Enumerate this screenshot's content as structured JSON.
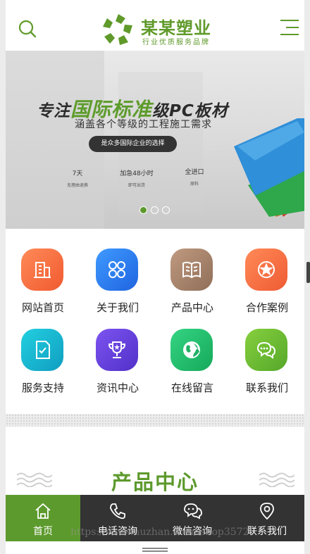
{
  "header": {
    "brand_name": "某某塑业",
    "brand_slogan": "行业优质服务品牌",
    "brand_color": "#5f9a2a"
  },
  "banner": {
    "headline_prefix": "专注",
    "headline_highlight": "国际标准",
    "headline_suffix": "级PC板材",
    "subline": "涵盖各个等级的工程施工需求",
    "pill_text": "是众多国际企业的选择",
    "features": [
      {
        "title": "7天",
        "sub": "无理由退换"
      },
      {
        "title": "加急48小时",
        "sub": "即可出货"
      },
      {
        "title": "全进口",
        "sub": "原料"
      }
    ],
    "slides": [
      "1",
      "2",
      "3"
    ],
    "active_slide": 0
  },
  "nav_grid": [
    {
      "label": "网站首页",
      "icon": "building-icon",
      "color": "#f36b3c"
    },
    {
      "label": "关于我们",
      "icon": "clover-icon",
      "color": "#2f7ff0"
    },
    {
      "label": "产品中心",
      "icon": "book-icon",
      "color": "#a6836c"
    },
    {
      "label": "合作案例",
      "icon": "star-badge-icon",
      "color": "#f2693c"
    },
    {
      "label": "服务支持",
      "icon": "document-check-icon",
      "color": "#17b4d0"
    },
    {
      "label": "资讯中心",
      "icon": "trophy-icon",
      "color": "#6a44d8"
    },
    {
      "label": "在线留言",
      "icon": "globe-icon",
      "color": "#2bc06e"
    },
    {
      "label": "联系我们",
      "icon": "chat-bubbles-icon",
      "color": "#6fbc32"
    }
  ],
  "section": {
    "title": "产品中心"
  },
  "bottom_nav": [
    {
      "label": "首页",
      "icon": "home-icon"
    },
    {
      "label": "电话咨询",
      "icon": "phone-icon"
    },
    {
      "label": "微信咨询",
      "icon": "wechat-icon"
    },
    {
      "label": "联系我们",
      "icon": "location-icon"
    }
  ],
  "watermark": "https://www.huzhan.com/ishop3572"
}
